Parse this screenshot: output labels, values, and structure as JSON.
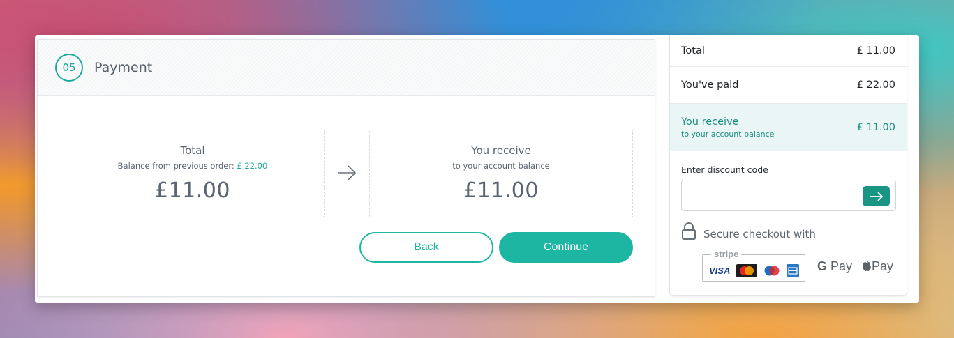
{
  "step": {
    "number": "05",
    "title": "Payment"
  },
  "total_box": {
    "label": "Total",
    "sub_prefix": "Balance from previous order: ",
    "sub_amount": "£ 22.00",
    "amount": "£11.00"
  },
  "receive_box": {
    "label": "You receive",
    "sub": "to your account balance",
    "amount": "£11.00"
  },
  "buttons": {
    "back": "Back",
    "continue": "Continue"
  },
  "summary": {
    "total_label": "Total",
    "total_value": "£ 11.00",
    "paid_label": "You've paid",
    "paid_value": "£ 22.00",
    "receive_label": "You receive",
    "receive_sub": "to your account balance",
    "receive_value": "£ 11.00"
  },
  "discount": {
    "label": "Enter discount code",
    "value": "",
    "placeholder": ""
  },
  "secure": {
    "text": "Secure checkout with"
  },
  "payment_methods": {
    "stripe": "stripe",
    "visa": "VISA",
    "gpay": "Pay",
    "applepay": "Pay"
  },
  "colors": {
    "accent": "#1db6a2",
    "accent_dark": "#1a9484",
    "text": "#5b6470"
  },
  "icons": [
    "arrow-right-icon",
    "lock-icon",
    "mastercard-icon",
    "maestro-icon",
    "amex-icon",
    "google-icon",
    "apple-icon"
  ]
}
